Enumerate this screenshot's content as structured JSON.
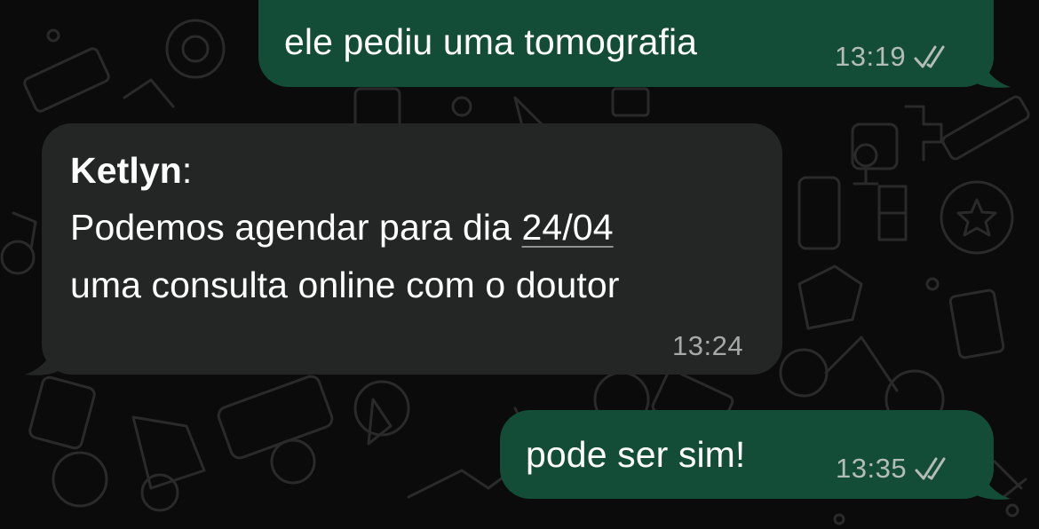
{
  "chat": {
    "background_color": "#0b0b0b",
    "outgoing_bubble_color": "#144d37",
    "incoming_bubble_color": "#242626",
    "messages": [
      {
        "direction": "outgoing",
        "text": "ele pediu uma tomografia",
        "time": "13:19",
        "status_icon": "double-check-read-icon"
      },
      {
        "direction": "incoming",
        "sender": "Ketlyn",
        "sender_suffix": ":",
        "line1_prefix": "Podemos agendar para dia ",
        "date": "24/04",
        "line2": "uma consulta online com o doutor",
        "time": "13:24"
      },
      {
        "direction": "outgoing",
        "text": "pode ser sim!",
        "time": "13:35",
        "status_icon": "double-check-read-icon"
      }
    ]
  }
}
